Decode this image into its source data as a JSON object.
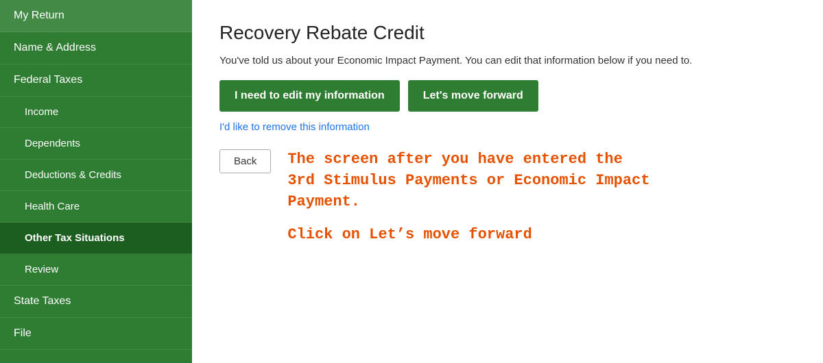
{
  "sidebar": {
    "items": [
      {
        "id": "my-return",
        "label": "My Return",
        "sub": false,
        "active": false
      },
      {
        "id": "name-address",
        "label": "Name & Address",
        "sub": false,
        "active": false
      },
      {
        "id": "federal-taxes",
        "label": "Federal Taxes",
        "sub": false,
        "active": false
      },
      {
        "id": "income",
        "label": "Income",
        "sub": true,
        "active": false
      },
      {
        "id": "dependents",
        "label": "Dependents",
        "sub": true,
        "active": false
      },
      {
        "id": "deductions-credits",
        "label": "Deductions & Credits",
        "sub": true,
        "active": false
      },
      {
        "id": "health-care",
        "label": "Health Care",
        "sub": true,
        "active": false
      },
      {
        "id": "other-tax-situations",
        "label": "Other Tax Situations",
        "sub": true,
        "active": true
      },
      {
        "id": "review",
        "label": "Review",
        "sub": true,
        "active": false
      },
      {
        "id": "state-taxes",
        "label": "State Taxes",
        "sub": false,
        "active": false
      },
      {
        "id": "file",
        "label": "File",
        "sub": false,
        "active": false
      }
    ]
  },
  "main": {
    "title": "Recovery Rebate Credit",
    "subtitle": "You've told us about your Economic Impact Payment. You can edit that information below if you need to.",
    "btn_edit_label": "I need to edit my information",
    "btn_forward_label": "Let's move forward",
    "link_remove_label": "I'd like to remove this information",
    "btn_back_label": "Back",
    "annotation_line1": "The screen after you have entered the",
    "annotation_line2": "3rd Stimulus Payments or Economic Impact",
    "annotation_line3": "Payment.",
    "annotation_cta": "Click on Let’s move forward"
  }
}
